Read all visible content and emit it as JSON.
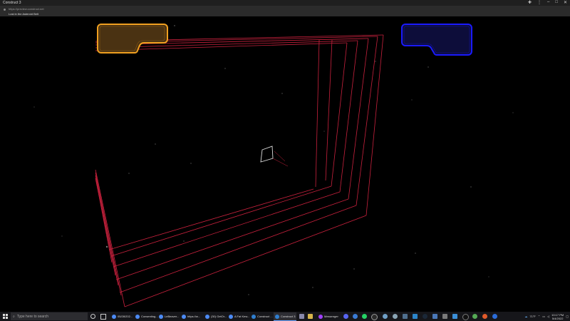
{
  "window": {
    "title": "Construct 3",
    "controls": [
      "puzzle-icon",
      "menu-icon",
      "minimize-icon",
      "maximize-icon",
      "close-icon"
    ]
  },
  "browser": {
    "url": "https://preview.construct.net",
    "page_title": "Lost in the Asteroid Belt"
  },
  "game": {
    "hud_left_color": "#f0a020",
    "hud_right_color": "#1a1aff",
    "grid_color": "#c8213d"
  },
  "taskbar": {
    "search_placeholder": "Type here to search",
    "tasks": [
      {
        "label": "05/28/202..."
      },
      {
        "label": "Consenting..."
      },
      {
        "label": "LeBeaver..."
      },
      {
        "label": "https://w..."
      },
      {
        "label": "(30) GetOr..."
      },
      {
        "label": "A Fat Kew..."
      },
      {
        "label": "Construct ..."
      },
      {
        "label": "Construct 3"
      },
      {
        "label": "Messenger"
      }
    ],
    "weather": "71°F",
    "time": "10:17 PM",
    "date": "5/4/2022"
  }
}
